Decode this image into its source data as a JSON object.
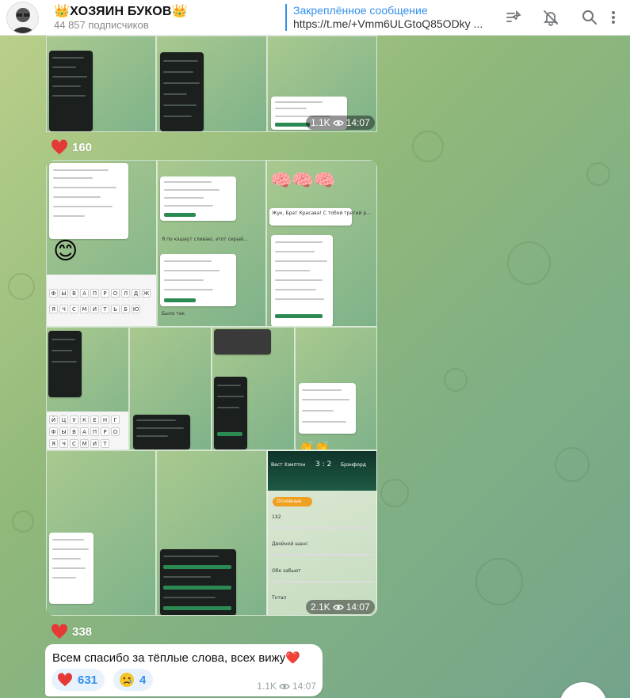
{
  "header": {
    "channel_title": "👑ХОЗЯИН БУКОВ👑",
    "subscribers": "44 857 подписчиков",
    "pinned_label": "Закреплённое сообщение",
    "pinned_text": "https://t.me/+Vmm6ULGtoQ85ODky ..."
  },
  "album1": {
    "views": "1.1K",
    "time": "14:07",
    "reaction_count": "160"
  },
  "album2": {
    "views": "2.1K",
    "time": "14:07",
    "reaction_count": "338"
  },
  "album2_tiles": {
    "screen_caption_1": "Жук, Брат Красава! С тобой третий р...",
    "screen_caption_2": "Я по кэшаут сливаю, этот серый...",
    "screen_caption_3": "Было так",
    "match_home": "Вест Хэмптон",
    "match_score": "3 : 2",
    "match_away": "Брэнфорд",
    "tab_all": "Основные",
    "market_1x2": "1X2",
    "market_double": "Двойной шанс",
    "market_both": "Обе забьют",
    "market_total": "Тотал"
  },
  "message": {
    "text": "Всем спасибо за тёплые слова, всех вижу❤️",
    "heart_count": "631",
    "sad_count": "4",
    "views": "1.1K",
    "time": "14:07"
  },
  "icons": [
    "channel-avatar",
    "pinned-list-icon",
    "mute-bell-icon",
    "search-icon",
    "more-vert-icon",
    "eye-icon",
    "heart-reaction-icon",
    "sad-reaction-icon"
  ],
  "colors": {
    "accent": "#3390ec",
    "heart": "#e53935",
    "header_bg": "#ffffff"
  }
}
